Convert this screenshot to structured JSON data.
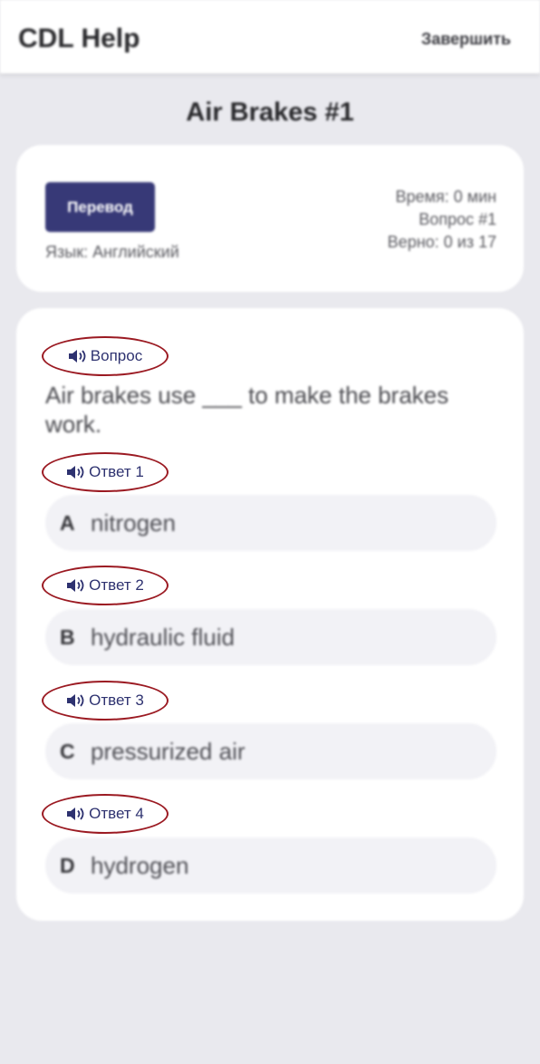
{
  "navbar": {
    "title": "CDL Help",
    "finish_label": "Завершить"
  },
  "page_title": "Air Brakes #1",
  "info": {
    "translate_label": "Перевод",
    "language": "Язык: Английский",
    "time": "Время: 0 мин",
    "question_number": "Вопрос #1",
    "correct": "Верно: 0 из 17"
  },
  "quiz": {
    "question_audio_label": "Вопрос",
    "question": "Air brakes use ___ to make the brakes work.",
    "answers": [
      {
        "audio_label": "Ответ 1",
        "letter": "A",
        "text": "nitrogen"
      },
      {
        "audio_label": "Ответ 2",
        "letter": "B",
        "text": "hydraulic fluid"
      },
      {
        "audio_label": "Ответ 3",
        "letter": "C",
        "text": "pressurized air"
      },
      {
        "audio_label": "Ответ 4",
        "letter": "D",
        "text": "hydrogen"
      }
    ]
  },
  "colors": {
    "accent": "#373977",
    "annotation_ring": "#9b1a22",
    "label_text": "#2e3270"
  },
  "icons": {
    "audio": "speaker-icon"
  }
}
